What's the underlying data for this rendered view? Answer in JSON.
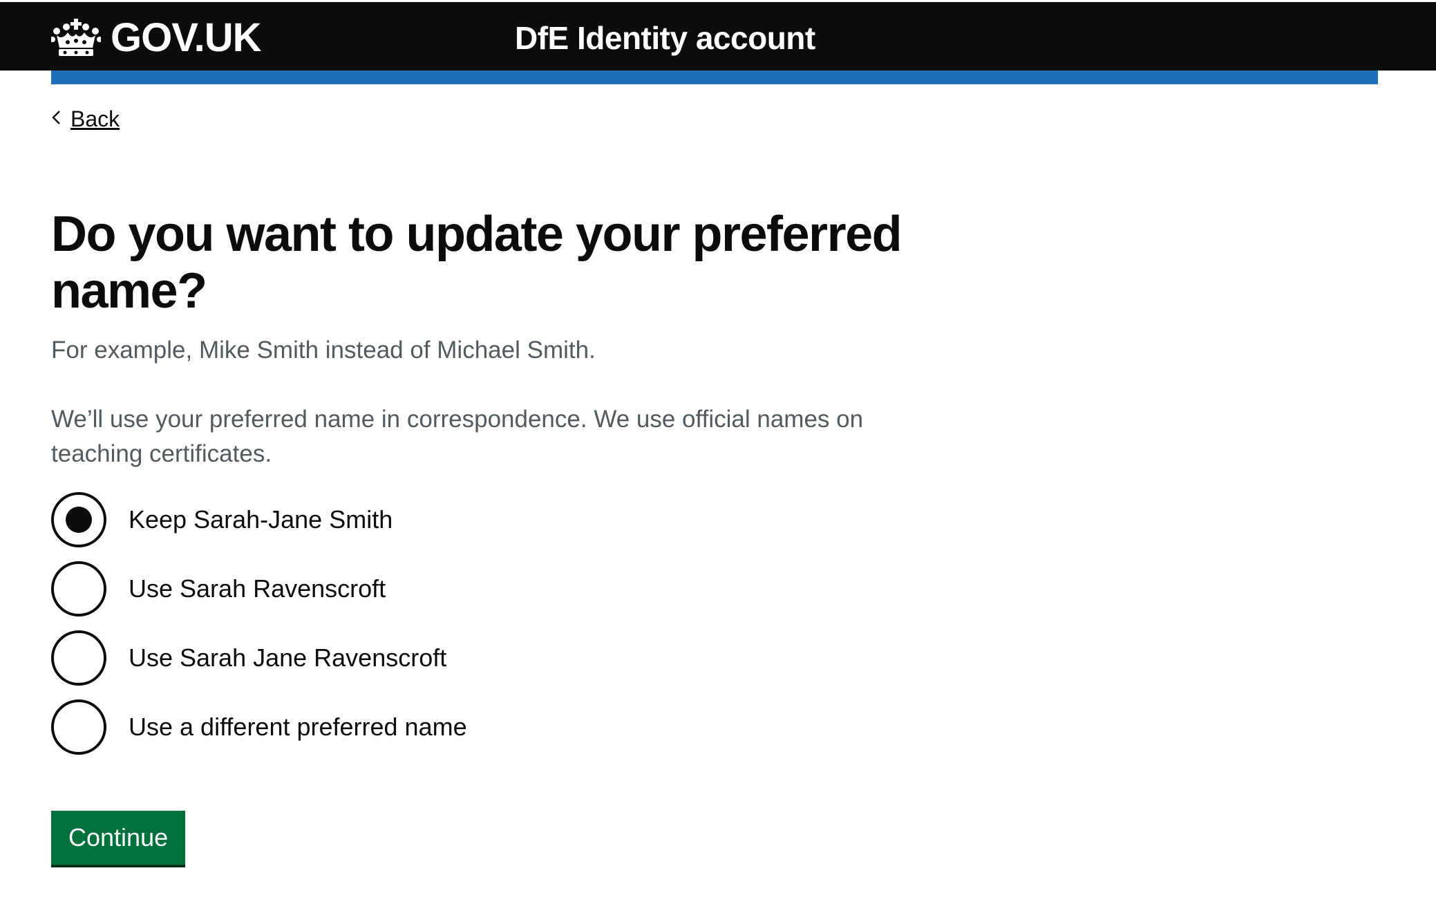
{
  "header": {
    "logo_text": "GOV.UK",
    "service_name": "DfE Identity account",
    "logo_icon": "crown-icon"
  },
  "back": {
    "label": "Back",
    "icon": "chevron-left-icon"
  },
  "main": {
    "title": "Do you want to update your preferred name?",
    "hint_example": "For example, Mike Smith instead of Michael Smith.",
    "hint_usage": "We’ll use your preferred name in correspondence. We use official names on teaching certificates."
  },
  "options": [
    {
      "label": "Keep Sarah-Jane Smith",
      "selected": true
    },
    {
      "label": "Use Sarah Ravenscroft",
      "selected": false
    },
    {
      "label": "Use Sarah Jane Ravenscroft",
      "selected": false
    },
    {
      "label": "Use a different preferred name",
      "selected": false
    }
  ],
  "actions": {
    "continue_label": "Continue"
  },
  "colors": {
    "header_bg": "#0b0c0c",
    "accent_blue": "#1d70b8",
    "button_green": "#00703c",
    "hint_grey": "#505a5f"
  }
}
